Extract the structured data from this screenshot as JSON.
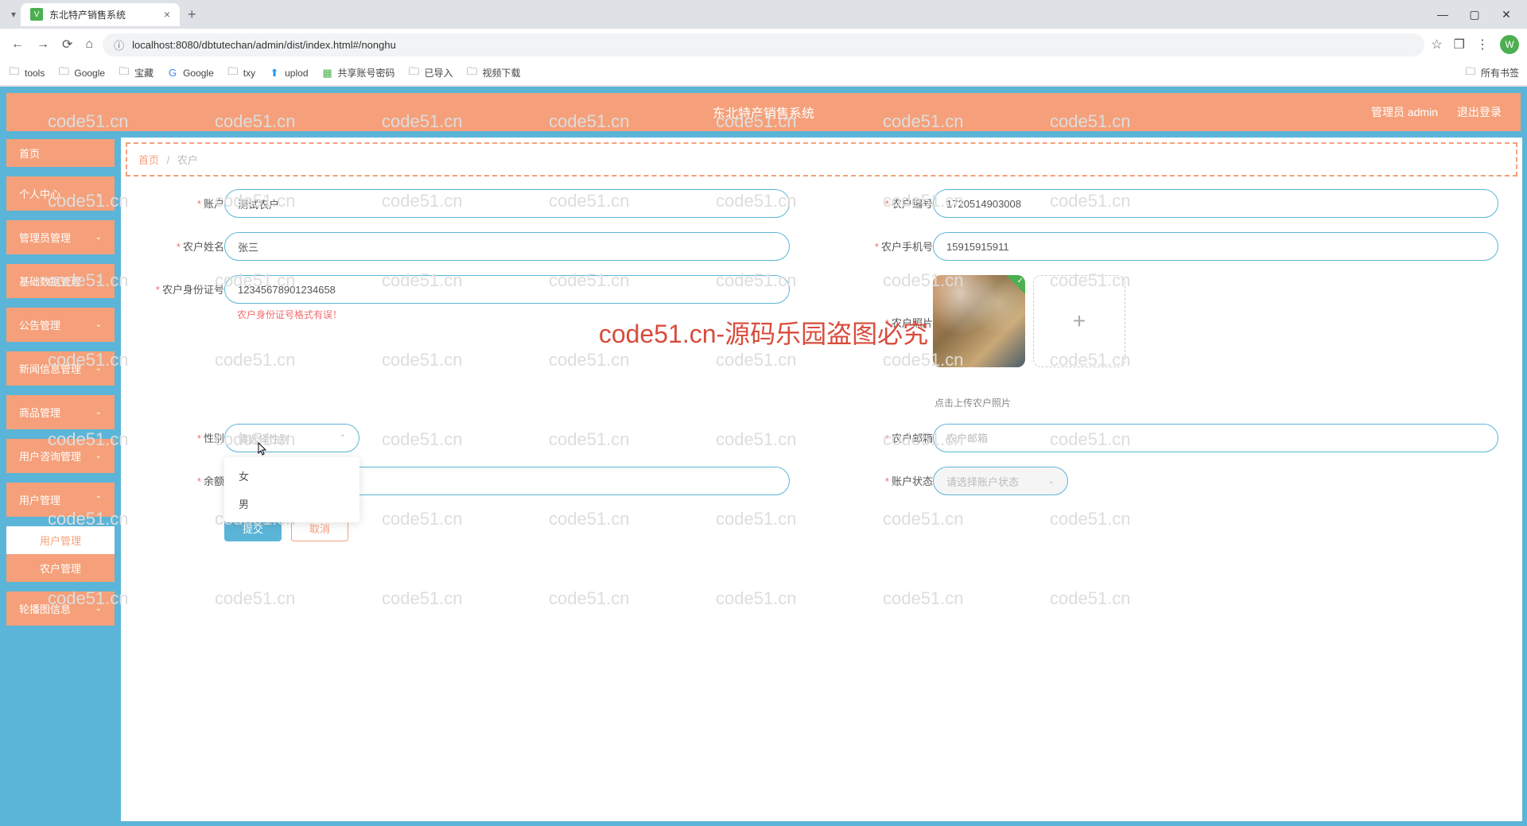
{
  "browser": {
    "tab_title": "东北特产销售系统",
    "url": "localhost:8080/dbtutechan/admin/dist/index.html#/nonghu",
    "bookmarks": [
      "tools",
      "Google",
      "宝藏",
      "Google",
      "txy",
      "uplod",
      "共享账号密码",
      "已导入",
      "视频下载"
    ],
    "all_bookmarks": "所有书签",
    "avatar_letter": "W"
  },
  "header": {
    "title": "东北特产销售系统",
    "user": "管理员 admin",
    "logout": "退出登录"
  },
  "sidebar": {
    "items": [
      {
        "label": "首页"
      },
      {
        "label": "个人中心"
      },
      {
        "label": "管理员管理"
      },
      {
        "label": "基础数据管理"
      },
      {
        "label": "公告管理"
      },
      {
        "label": "新闻信息管理"
      },
      {
        "label": "商品管理"
      },
      {
        "label": "用户咨询管理"
      },
      {
        "label": "用户管理"
      }
    ],
    "sub_items": [
      {
        "label": "用户管理",
        "active": false
      },
      {
        "label": "农户管理",
        "active": true
      }
    ],
    "footer_item": "轮播图信息"
  },
  "breadcrumb": {
    "home": "首页",
    "current": "农户"
  },
  "form": {
    "account": {
      "label": "账户",
      "value": "测试农户"
    },
    "farmer_no": {
      "label": "农户编号",
      "value": "1720514903008"
    },
    "farmer_name": {
      "label": "农户姓名",
      "value": "张三"
    },
    "farmer_phone": {
      "label": "农户手机号",
      "value": "15915915911"
    },
    "farmer_id": {
      "label": "农户身份证号",
      "value": "12345678901234658",
      "error": "农户身份证号格式有误！"
    },
    "farmer_photo": {
      "label": "农户照片",
      "hint": "点击上传农户照片"
    },
    "gender": {
      "label": "性别",
      "placeholder": "请选择性别",
      "options": [
        "女",
        "男"
      ]
    },
    "farmer_email": {
      "label": "农户邮箱",
      "placeholder": "农户邮箱"
    },
    "balance": {
      "label": "余额"
    },
    "account_status": {
      "label": "账户状态",
      "placeholder": "请选择账户状态"
    }
  },
  "actions": {
    "submit": "提交",
    "cancel": "取消"
  },
  "watermark": {
    "small": "code51.cn",
    "big": "code51.cn-源码乐园盗图必究"
  }
}
